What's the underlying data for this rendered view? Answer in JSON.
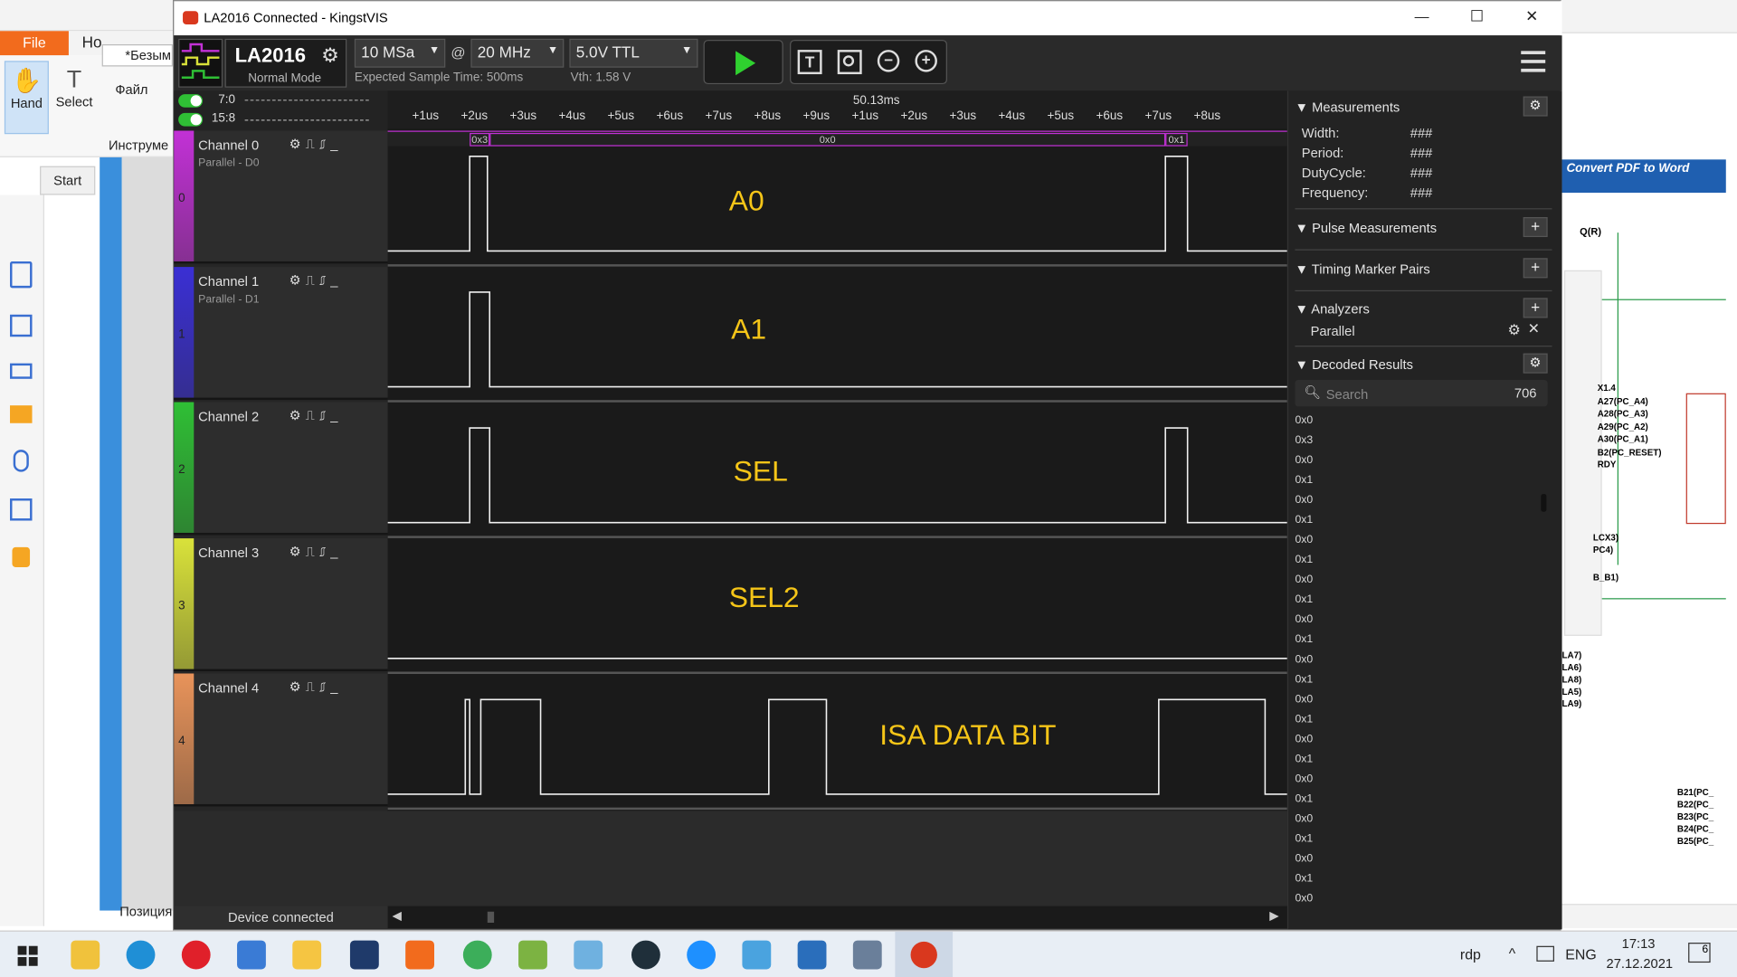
{
  "background_app": {
    "file_tab": "File",
    "home_tab_partial": "Ho",
    "hand_label": "Hand",
    "select_label": "Select",
    "start_tab": "Start",
    "doc_title_partial": "*Безым",
    "menu_file": "Файл",
    "tools_partial": "Инструме",
    "position_label": "Позиция",
    "convert_banner": "Convert PDF to Word",
    "schematic_labels": [
      "Q(R)",
      "X1.4",
      "A27(PC_A4)",
      "A28(PC_A3)",
      "A29(PC_A2)",
      "A30(PC_A1)",
      "B2(PC_RESET)",
      "RDY",
      "LCX3)",
      "PC4)",
      "B_B1)",
      "LA7)",
      "LA6)",
      "LA8)",
      "LA5)",
      "LA9)",
      "B21(PC_",
      "B22(PC_",
      "B23(PC_",
      "B24(PC_",
      "B25(PC_"
    ]
  },
  "window": {
    "title": "LA2016 Connected - KingstVIS",
    "min": "—",
    "max": "☐",
    "close": "✕"
  },
  "toolbar": {
    "device": "LA2016",
    "mode": "Normal Mode",
    "sample_depth": "10 MSa",
    "at": "@",
    "sample_rate": "20 MHz",
    "voltage": "5.0V TTL",
    "expected_time": "Expected Sample Time: 500ms",
    "vth": "Vth: 1.58 V"
  },
  "group_toggles": [
    {
      "label": "7:0"
    },
    {
      "label": "15:8"
    }
  ],
  "time_ruler": {
    "center_label": "50.13ms",
    "ticks": [
      "+1us",
      "+2us",
      "+3us",
      "+4us",
      "+5us",
      "+6us",
      "+7us",
      "+8us",
      "+9us",
      "+1us",
      "+2us",
      "+3us",
      "+4us",
      "+5us",
      "+6us",
      "+7us",
      "+8us"
    ]
  },
  "decode_bar": [
    "0x3",
    "0x0",
    "0x1"
  ],
  "channels": [
    {
      "name": "Channel 0",
      "sub": "Parallel - D0",
      "num": "0",
      "color": "#c231d6",
      "annotation": "A0"
    },
    {
      "name": "Channel 1",
      "sub": "Parallel - D1",
      "num": "1",
      "color": "#3a2fd4",
      "annotation": "A1"
    },
    {
      "name": "Channel 2",
      "sub": "",
      "num": "2",
      "color": "#2fbf35",
      "annotation": "SEL"
    },
    {
      "name": "Channel 3",
      "sub": "",
      "num": "3",
      "color": "#d9e23a",
      "annotation": "SEL2"
    },
    {
      "name": "Channel 4",
      "sub": "",
      "num": "4",
      "color": "#e8935a",
      "annotation": "ISA DATA BIT"
    }
  ],
  "right_panel": {
    "measurements_title": "Measurements",
    "measurements": [
      {
        "label": "Width:",
        "value": "###"
      },
      {
        "label": "Period:",
        "value": "###"
      },
      {
        "label": "DutyCycle:",
        "value": "###"
      },
      {
        "label": "Frequency:",
        "value": "###"
      }
    ],
    "pulse_title": "Pulse Measurements",
    "timing_title": "Timing Marker Pairs",
    "analyzers_title": "Analyzers",
    "analyzer_item": "Parallel",
    "decoded_title": "Decoded Results",
    "search_placeholder": "Search",
    "result_count": "706",
    "results": [
      "0x0",
      "0x3",
      "0x0",
      "0x1",
      "0x0",
      "0x1",
      "0x0",
      "0x1",
      "0x0",
      "0x1",
      "0x0",
      "0x1",
      "0x0",
      "0x1",
      "0x0",
      "0x1",
      "0x0",
      "0x1",
      "0x0",
      "0x1",
      "0x0",
      "0x1",
      "0x0",
      "0x1",
      "0x0"
    ]
  },
  "status": {
    "device_connected": "Device connected"
  },
  "taskbar": {
    "rdp": "rdp",
    "lang": "ENG",
    "time": "17:13",
    "date": "27.12.2021",
    "notifications": "6"
  }
}
